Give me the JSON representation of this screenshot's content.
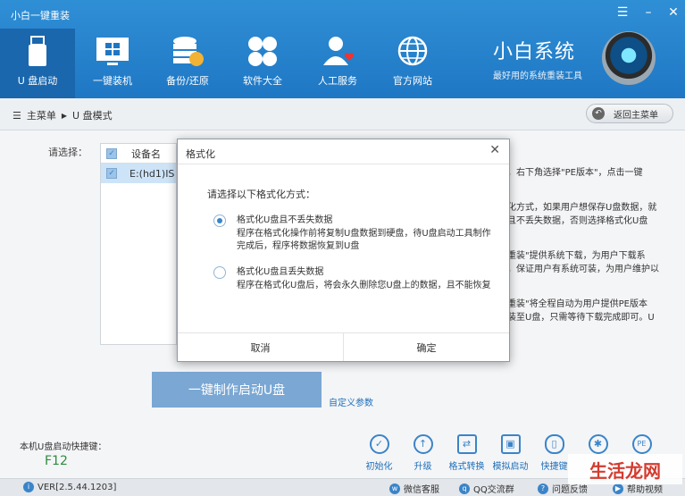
{
  "app": {
    "title": "小白一键重装"
  },
  "nav": [
    {
      "label": "U 盘启动",
      "icon": "usb-drive-icon"
    },
    {
      "label": "一键装机",
      "icon": "windows-monitor-icon"
    },
    {
      "label": "备份/还原",
      "icon": "database-icon"
    },
    {
      "label": "软件大全",
      "icon": "apps-grid-icon"
    },
    {
      "label": "人工服务",
      "icon": "person-heart-icon"
    },
    {
      "label": "官方网站",
      "icon": "globe-icon"
    }
  ],
  "brand": {
    "name": "小白系统",
    "slogan": "最好用的系统重装工具"
  },
  "breadcrumb": {
    "root": "主菜单",
    "current": "U 盘模式",
    "back_label": "返回主菜单"
  },
  "device": {
    "choose_label": "请选择：",
    "header": "设备名",
    "row": "E:(hd1)IS"
  },
  "notes": [
    "，右下角选择\"PE版本\"，点击一键",
    "化方式，如果用户想保存U盘数据，就",
    "且不丢失数据，否则选择格式化U盘",
    "重装\"提供系统下载，为用户下载系",
    "，保证用户有系统可装，为用户维护以",
    "重装\"将全程自动为用户提供PE版本",
    "装至U盘，只需等待下载完成即可。U"
  ],
  "actions": {
    "make_label": "一键制作启动U盘",
    "custom_label": "自定义参数"
  },
  "hotkey": {
    "label": "本机U盘启动快捷键：",
    "value": "F12"
  },
  "tools": [
    {
      "label": "初始化",
      "icon": "check-circle-icon"
    },
    {
      "label": "升级",
      "icon": "upgrade-arrow-icon"
    },
    {
      "label": "格式转换",
      "icon": "convert-icon"
    },
    {
      "label": "模拟启动",
      "icon": "simulate-icon"
    },
    {
      "label": "快捷键",
      "icon": "mouse-icon"
    },
    {
      "label": "",
      "icon": "gear-icon"
    },
    {
      "label": "",
      "icon": "pe-icon"
    }
  ],
  "status": {
    "version": "VER[2.5.44.1203]",
    "wechat": "微信客服",
    "qq": "QQ交流群",
    "feedback": "问题反馈",
    "help": "帮助视频"
  },
  "watermark": "生活龙网",
  "modal": {
    "title": "格式化",
    "prompt": "请选择以下格式化方式：",
    "option1_title": "格式化U盘且不丢失数据",
    "option1_desc1": "程序在格式化操作前将复制U盘数据到硬盘，待U盘启动工具制作",
    "option1_desc2": "完成后，程序将数据恢复到U盘",
    "option2_title": "格式化U盘且丢失数据",
    "option2_desc": "程序在格式化U盘后，将会永久删除您U盘上的数据，且不能恢复",
    "cancel_label": "取消",
    "ok_label": "确定",
    "selected_option": 1
  }
}
